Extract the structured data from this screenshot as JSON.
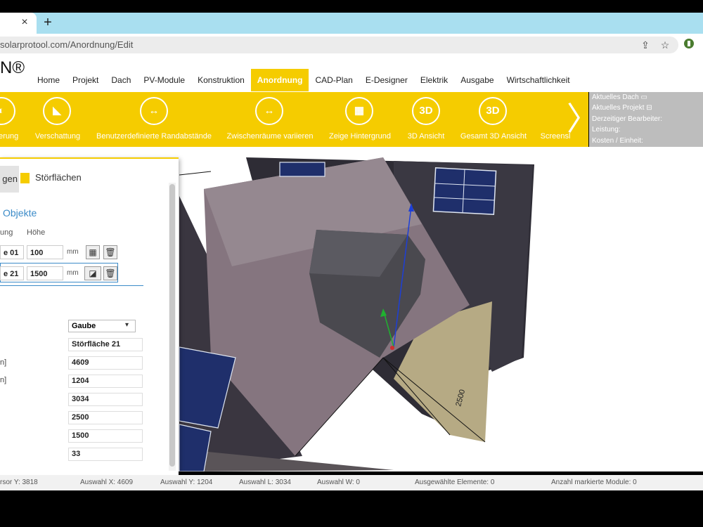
{
  "browser": {
    "tab_close": "×",
    "new_tab": "+",
    "url": "solarprotool.com/Anordnung/Edit",
    "icons": [
      "share-icon",
      "star-icon",
      "extension-icon"
    ]
  },
  "app": {
    "logo": "N®",
    "menu": [
      "Home",
      "Projekt",
      "Dach",
      "PV-Module",
      "Konstruktion",
      "Anordnung",
      "CAD-Plan",
      "E-Designer",
      "Elektrik",
      "Ausgabe",
      "Wirtschaftlichkeit"
    ],
    "active_menu": "Anordnung"
  },
  "toolbar": {
    "tools": [
      {
        "label": "ierung",
        "icon": "rotate-icon",
        "glyph": "◐"
      },
      {
        "label": "Verschattung",
        "icon": "shading-icon",
        "glyph": "◣"
      },
      {
        "label": "Benutzerdefinierte Randabstände",
        "icon": "edge-distance-icon",
        "glyph": "↔"
      },
      {
        "label": "Zwischenräume variieren",
        "icon": "gap-icon",
        "glyph": "↔"
      },
      {
        "label": "Zeige Hintergrund",
        "icon": "background-image-icon",
        "glyph": "▦"
      },
      {
        "label": "3D Ansicht",
        "icon": "3d-view-icon",
        "glyph": "3D"
      },
      {
        "label": "Gesamt 3D Ansicht",
        "icon": "3d-total-view-icon",
        "glyph": "3D"
      },
      {
        "label": "Screensl",
        "icon": "screenshot-icon",
        "glyph": ""
      }
    ],
    "next": "〉"
  },
  "info_panel": {
    "rows": [
      "Aktuelles Dach",
      "Aktuelles Projekt",
      "Derzeitiger Bearbeiter:",
      "Leistung:",
      "Kosten / Einheit:"
    ]
  },
  "left_panel": {
    "tab1": "gen",
    "tab2": "Störflächen",
    "title": "Objekte",
    "header_col1": "ung",
    "header_col2": "Höhe",
    "rows": [
      {
        "name": "e 01",
        "height": "100",
        "unit": "mm"
      },
      {
        "name": "e 21",
        "height": "1500",
        "unit": "mm"
      }
    ],
    "properties": [
      {
        "label": "",
        "value": "Gaube"
      },
      {
        "label": "",
        "value": "Störfläche 21"
      },
      {
        "label": "n]",
        "value": "4609"
      },
      {
        "label": "n]",
        "value": "1204"
      },
      {
        "label": "",
        "value": "3034"
      },
      {
        "label": "",
        "value": "2500"
      },
      {
        "label": "",
        "value": "1500"
      },
      {
        "label": "",
        "value": "33"
      }
    ]
  },
  "statusbar": {
    "items": [
      "rsor Y:  3818",
      "Auswahl X:  4609",
      "Auswahl Y:  1204",
      "Auswahl L:  3034",
      "Auswahl W:  0",
      "Ausgewählte Elemente:  0",
      "Anzahl markierte Module:  0"
    ]
  },
  "viewport": {
    "dimension_label": "2500"
  }
}
